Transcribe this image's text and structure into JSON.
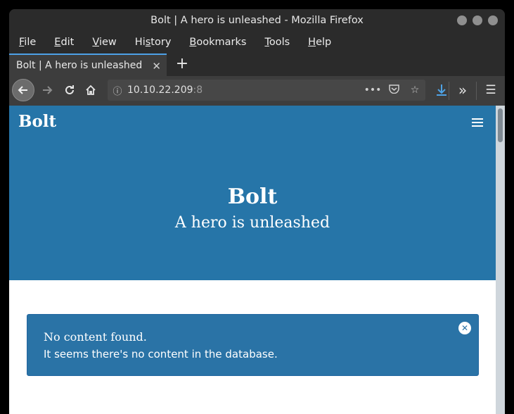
{
  "window": {
    "title": "Bolt | A hero is unleashed - Mozilla Firefox"
  },
  "menubar": {
    "items": [
      {
        "u": "F",
        "rest": "ile"
      },
      {
        "u": "E",
        "rest": "dit"
      },
      {
        "u": "V",
        "rest": "iew"
      },
      {
        "pre": "Hi",
        "u": "s",
        "rest": "tory"
      },
      {
        "u": "B",
        "rest": "ookmarks"
      },
      {
        "u": "T",
        "rest": "ools"
      },
      {
        "u": "H",
        "rest": "elp"
      }
    ]
  },
  "tab": {
    "label": "Bolt | A hero is unleashed",
    "close": "✕",
    "new_tab": "+"
  },
  "navbar": {
    "url_host": "10.10.22.209",
    "url_port": ":8",
    "more": "•••",
    "overflow": "»",
    "menu": "☰"
  },
  "site": {
    "brand": "Bolt",
    "hero_title": "Bolt",
    "hero_subtitle": "A hero is unleashed",
    "alert_line1": "No content found.",
    "alert_line2": "It seems there's no content in the database.",
    "alert_dismiss": "✕"
  },
  "colors": {
    "accent": "#2675a8",
    "alert_bg": "#2a73a6"
  }
}
